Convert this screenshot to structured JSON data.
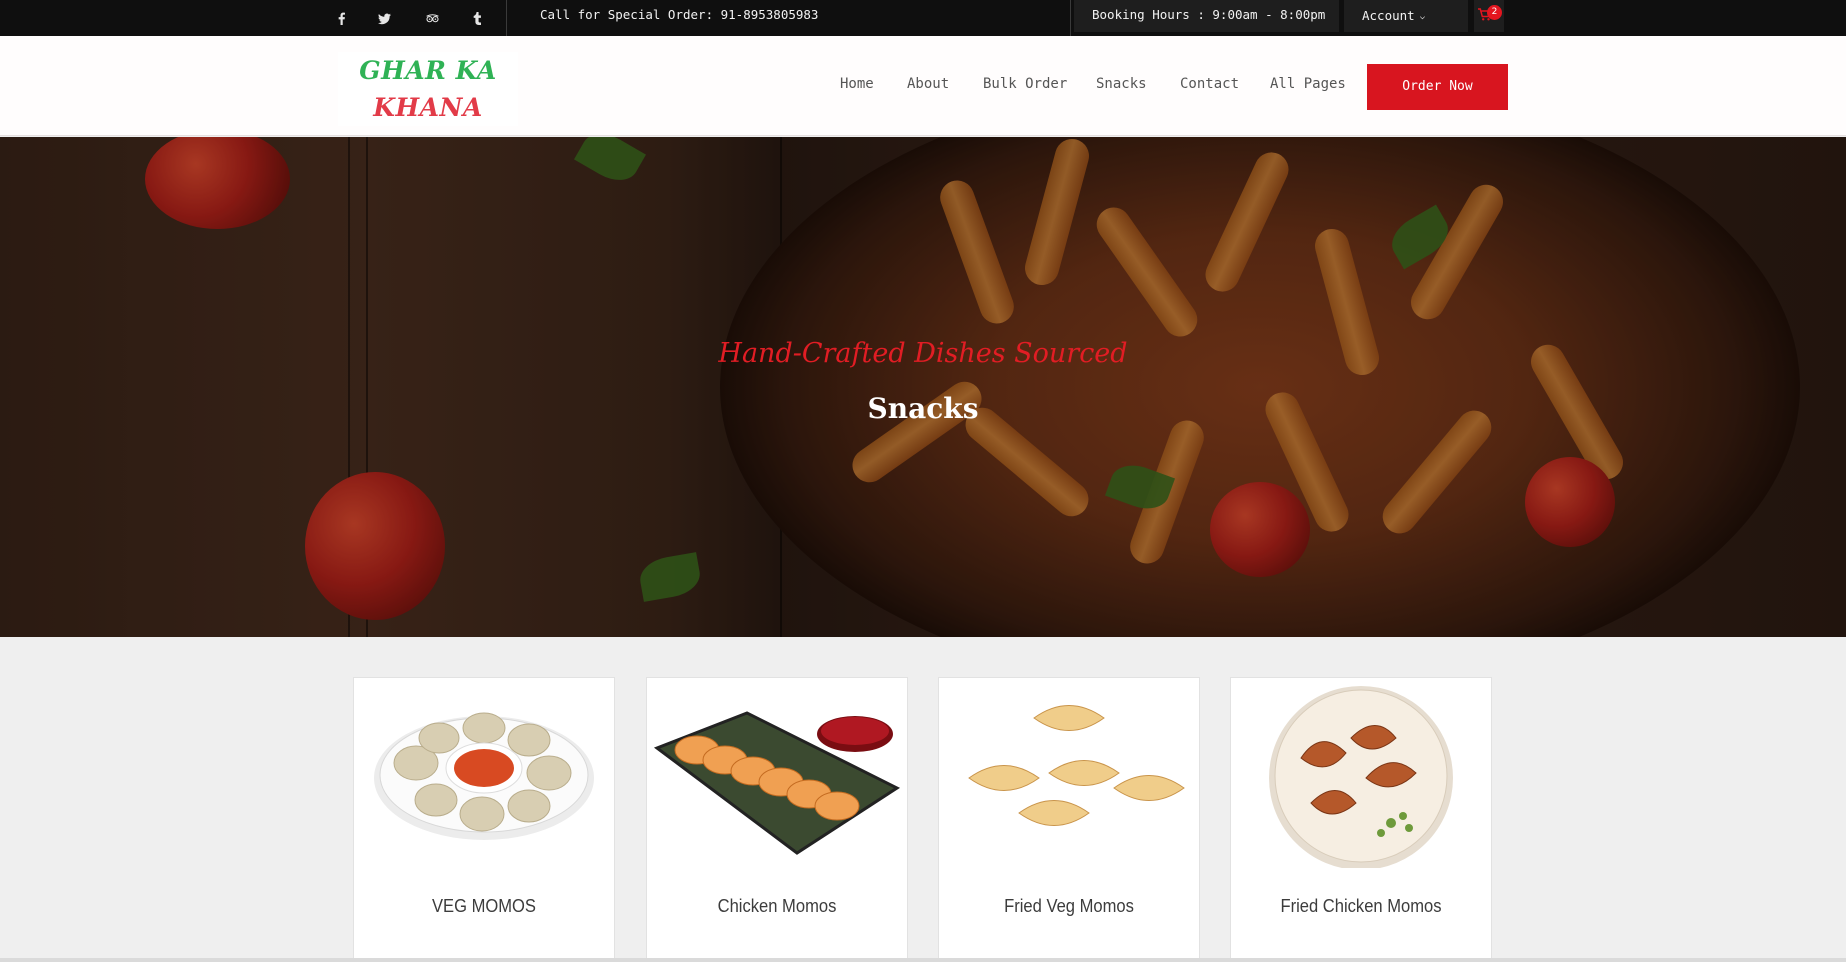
{
  "topbar": {
    "social_icons": [
      "facebook-icon",
      "twitter-icon",
      "tripadvisor-icon",
      "tumblr-icon"
    ],
    "call_text": "Call for Special Order: 91-8953805983",
    "booking_text": "Booking Hours : 9:00am - 8:00pm",
    "account_label": "Account",
    "cart_count": "2"
  },
  "header": {
    "logo_line1": "GHAR KA",
    "logo_line2": "KHANA",
    "nav": [
      "Home",
      "About",
      "Bulk Order",
      "Snacks",
      "Contact",
      "All Pages"
    ],
    "order_button": "Order Now"
  },
  "hero": {
    "subtitle": "Hand-Crafted Dishes Sourced",
    "title": "Snacks"
  },
  "products": [
    {
      "name": "VEG MOMOS"
    },
    {
      "name": "Chicken Momos"
    },
    {
      "name": "Fried Veg Momos"
    },
    {
      "name": "Fried Chicken Momos"
    }
  ],
  "colors": {
    "accent_red": "#d8151f",
    "logo_green": "#2fb255",
    "logo_red": "#e23b48",
    "topbar_bg": "#0f0f0f"
  }
}
